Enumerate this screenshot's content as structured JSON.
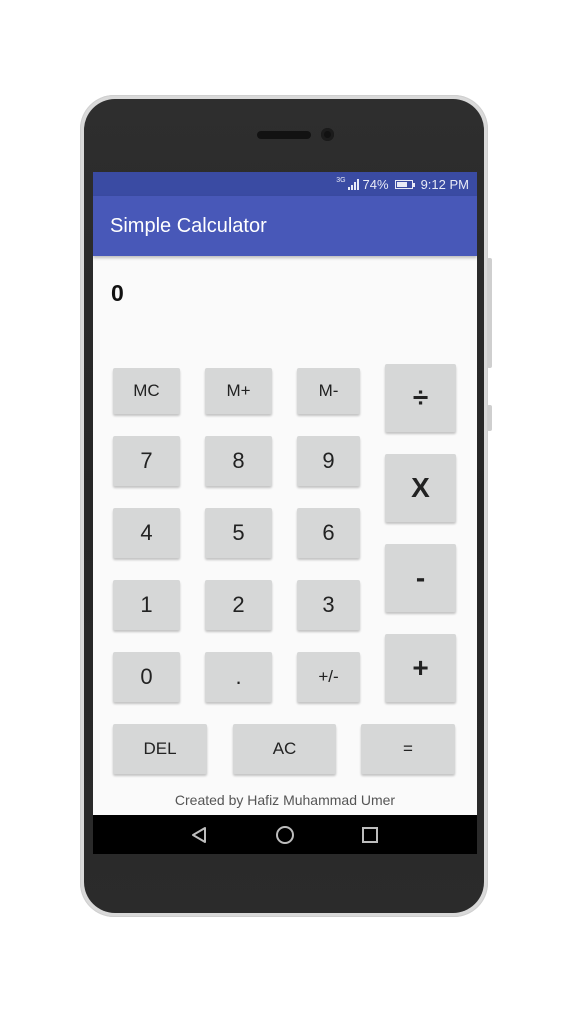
{
  "status_bar": {
    "network": "3G",
    "battery": "74%",
    "battery_level": 0.74,
    "time": "9:12 PM"
  },
  "app_bar": {
    "title": "Simple Calculator"
  },
  "display": {
    "value": "0"
  },
  "buttons": {
    "mc": "MC",
    "m_plus": "M+",
    "m_minus": "M-",
    "divide": "÷",
    "multiply": "X",
    "subtract": "-",
    "add": "+",
    "d7": "7",
    "d8": "8",
    "d9": "9",
    "d4": "4",
    "d5": "5",
    "d6": "6",
    "d1": "1",
    "d2": "2",
    "d3": "3",
    "d0": "0",
    "dot": ".",
    "sign": "+/-",
    "del": "DEL",
    "ac": "AC",
    "equals": "="
  },
  "footer": {
    "credit": "Created by Hafiz Muhammad Umer"
  },
  "nav": {
    "back": "back-icon",
    "home": "home-icon",
    "recents": "recents-icon"
  },
  "colors": {
    "app_bar": "#4858b8",
    "status_bar": "#3a4ba3",
    "button": "#d6d7d7"
  }
}
